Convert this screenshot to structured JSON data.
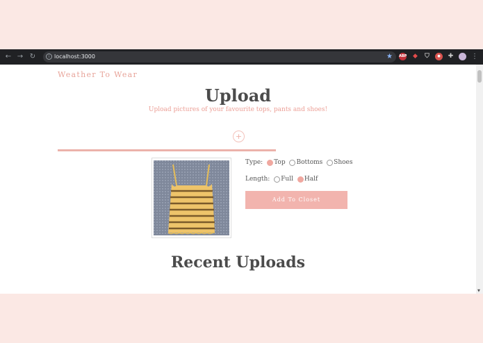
{
  "browser": {
    "url": "localhost:3000",
    "extensions": [
      "abp-icon",
      "extension-red-icon",
      "shield-icon",
      "extension-red-2-icon",
      "puzzle-icon",
      "profile-avatar"
    ]
  },
  "page": {
    "brand": "Weather To Wear",
    "title": "Upload",
    "subtitle": "Upload pictures of your favourite tops, pants and shoes!",
    "add_symbol": "+",
    "upload_progress": 1.0,
    "type_label": "Type:",
    "type_options": [
      {
        "label": "Top",
        "checked": true
      },
      {
        "label": "Bottoms",
        "checked": false
      },
      {
        "label": "Shoes",
        "checked": false
      }
    ],
    "length_label": "Length:",
    "length_options": [
      {
        "label": "Full",
        "checked": false
      },
      {
        "label": "Half",
        "checked": true
      }
    ],
    "add_button": "Add To Closet",
    "recent_title": "Recent Uploads"
  },
  "colors": {
    "accent": "#f2b4ae",
    "background": "#fbe8e4",
    "heading": "#4b4b4b"
  }
}
